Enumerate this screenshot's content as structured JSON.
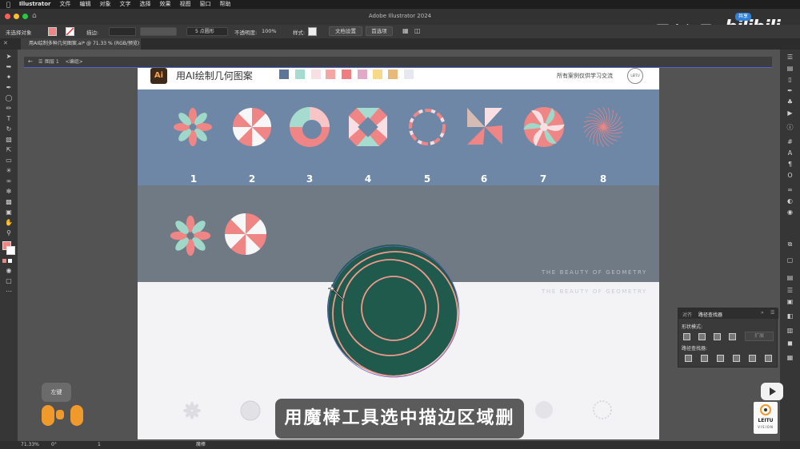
{
  "menubar": {
    "app_name": "Illustrator",
    "items": [
      "文件",
      "编辑",
      "对象",
      "文字",
      "选择",
      "效果",
      "视图",
      "窗口",
      "帮助"
    ]
  },
  "window": {
    "title": "Adobe Illustrator 2024"
  },
  "control_bar": {
    "selection": "未选择对象",
    "stroke_label": "描边:",
    "brush_label": "5 点圆形",
    "opacity_label": "不透明度:",
    "opacity_value": "100%",
    "style_label": "样式:",
    "doc_setup": "文档设置",
    "preferences": "首选项"
  },
  "document_tab": {
    "label": "用AI绘制多种几何图案.ai* @ 71.33 % (RGB/预览)"
  },
  "breadcrumb": {
    "layer": "图层 1",
    "group": "<编组>"
  },
  "artboard": {
    "header": {
      "logo": "Ai",
      "title": "用AI绘制几何图案",
      "right_text": "所有案例仅供学习交流",
      "seal_text": "LEITU",
      "palette": [
        "#5e7597",
        "#a6dccf",
        "#f7dfe3",
        "#f4a6a4",
        "#ef7e80",
        "#e1a9c7",
        "#f7d98a",
        "#e8b978",
        "#e7e7ef"
      ]
    },
    "numbers": [
      "1",
      "2",
      "3",
      "4",
      "5",
      "6",
      "7",
      "8"
    ],
    "beauty_text_1": "THE BEAUTY OF GEOMETRY",
    "beauty_text_2": "THE BEAUTY OF GEOMETRY",
    "colors": {
      "blue_band": "#6f87a6",
      "gray_band": "#707a84",
      "pink": "#ef8585",
      "mint": "#9fd8c8",
      "dark_green": "#1f5a4c",
      "salmon_stroke": "#f2998d"
    }
  },
  "caption": {
    "text": "用魔棒工具选中描边区域删掉"
  },
  "watermark": {
    "name": "磊土视界",
    "bilibili": "bilibili",
    "share": "共享"
  },
  "mouse_indicator": {
    "label": "左键"
  },
  "pathfinder": {
    "tab_align": "对齐",
    "tab_pathfinder": "路径查找器",
    "shape_modes": "形状模式:",
    "expand": "扩展",
    "pathfinders": "路径查找器:"
  },
  "status_bar": {
    "zoom": "71.33%",
    "rotation": "0°",
    "page": "1",
    "tool": "魔棒"
  },
  "leitu_logo": {
    "text": "LEITU",
    "sub": "VISION"
  }
}
